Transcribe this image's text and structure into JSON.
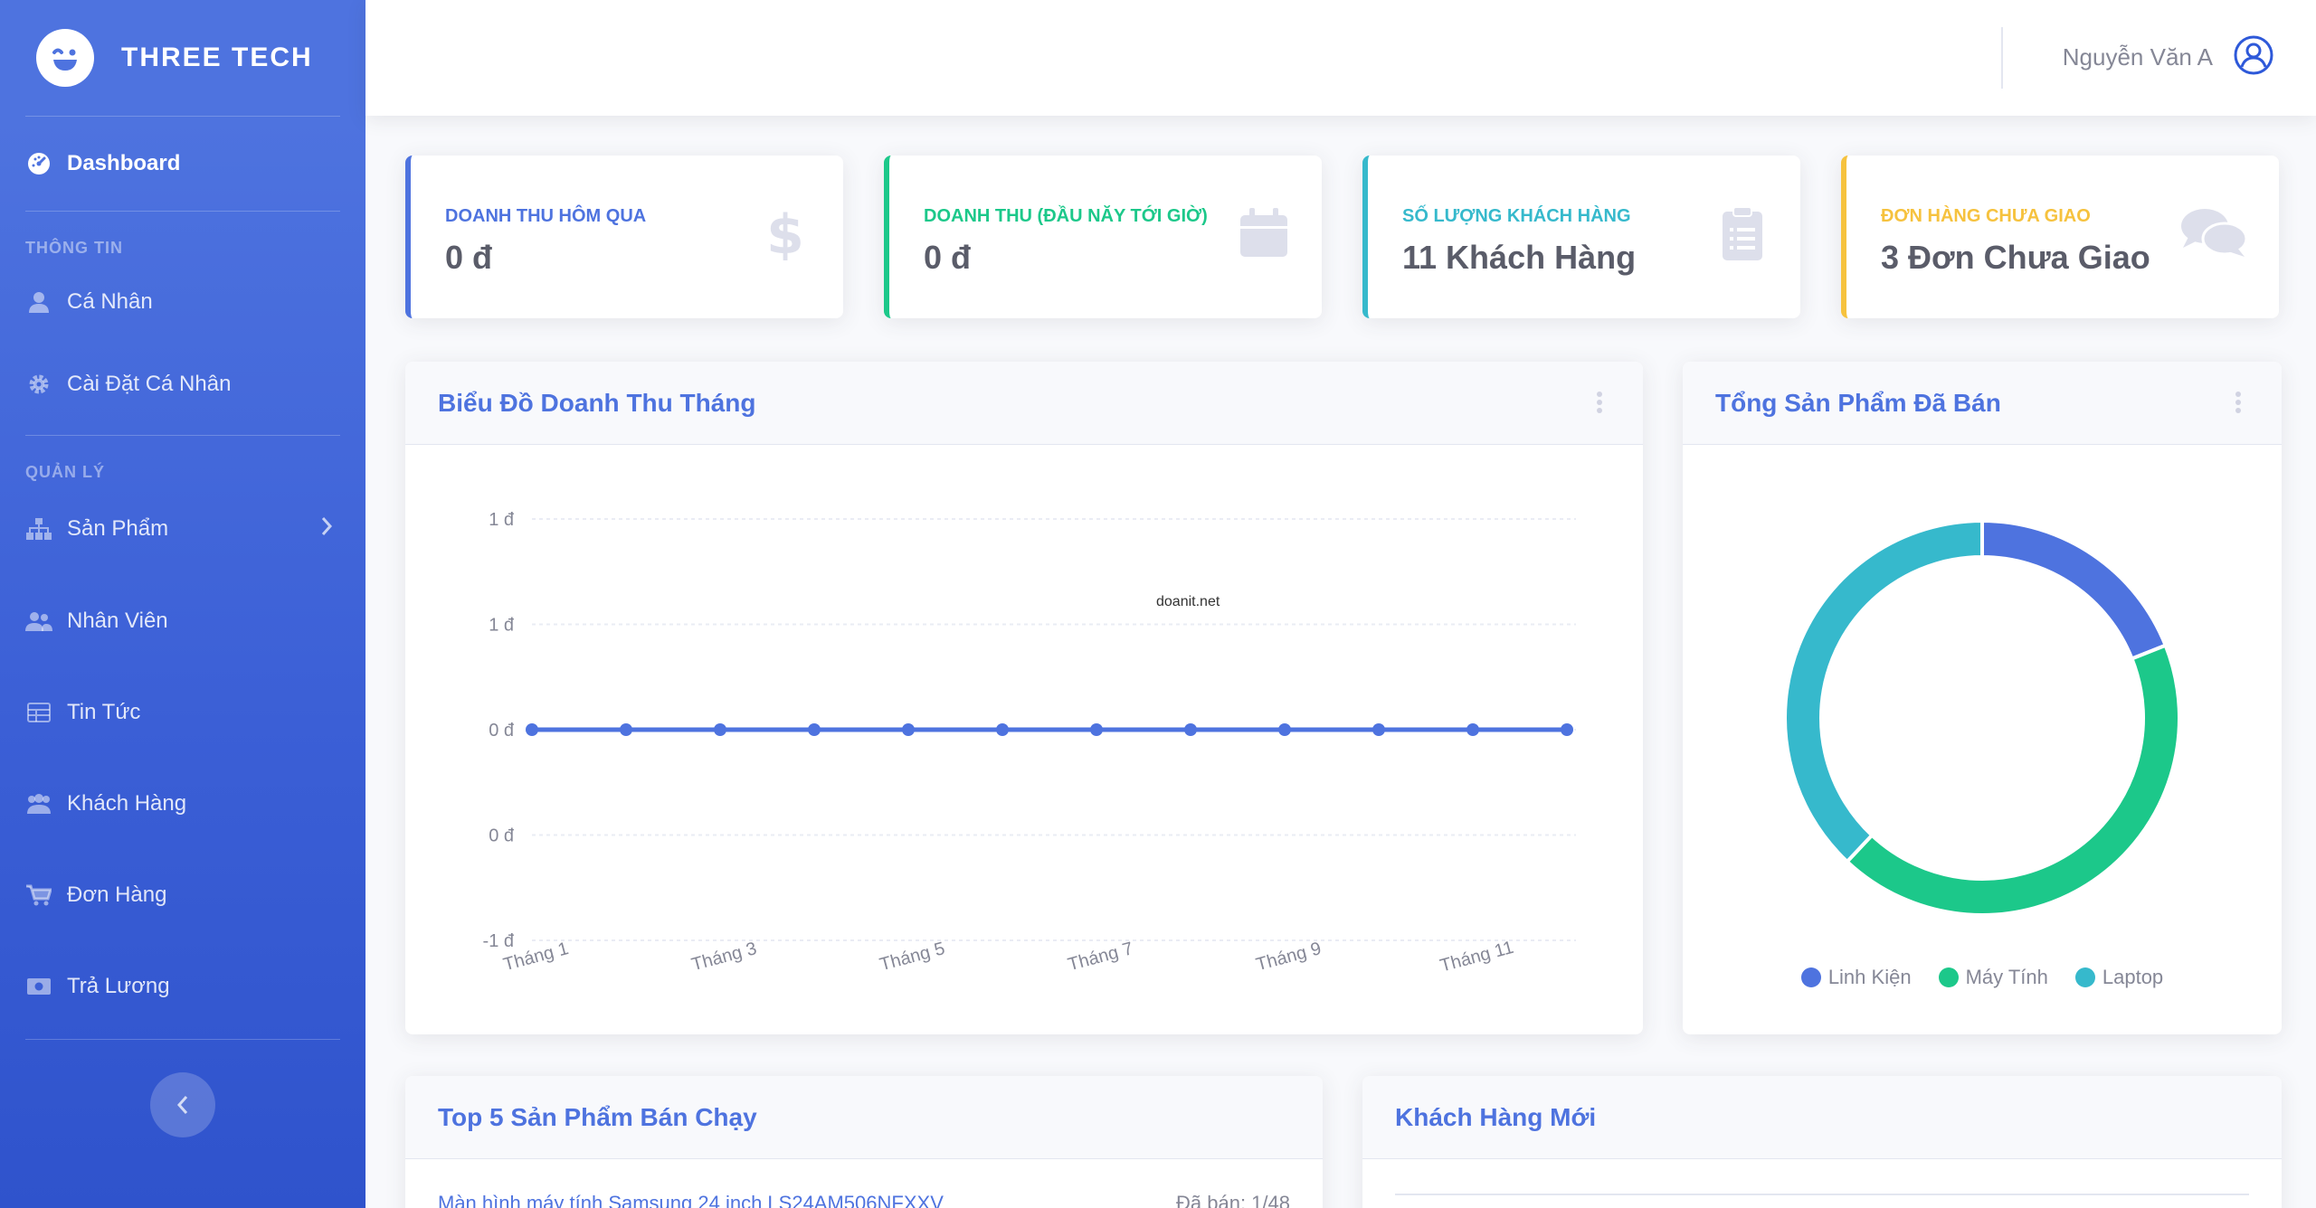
{
  "brand": {
    "name": "THREE TECH"
  },
  "sidebar": {
    "dashboard": "Dashboard",
    "section_info": "THÔNG TIN",
    "info_items": [
      "Cá Nhân",
      "Cài Đặt Cá Nhân"
    ],
    "section_manage": "QUẢN LÝ",
    "manage_items": [
      "Sản Phẩm",
      "Nhân Viên",
      "Tin Tức",
      "Khách Hàng",
      "Đơn Hàng",
      "Trả Lương"
    ]
  },
  "topbar": {
    "user_name": "Nguyễn Văn A"
  },
  "stats": [
    {
      "label": "DOANH THU HÔM QUA",
      "value": "0 đ",
      "color": "#4e73df",
      "icon": "dollar-icon"
    },
    {
      "label": "DOANH THU (ĐẦU NĂY TỚI GIỜ)",
      "value": "0 đ",
      "color": "#1cc88a",
      "icon": "calendar-icon"
    },
    {
      "label": "SỐ LƯỢNG KHÁCH HÀNG",
      "value": "11 Khách Hàng",
      "color": "#36b9cc",
      "icon": "clipboard-icon"
    },
    {
      "label": "ĐƠN HÀNG CHƯA GIAO",
      "value": "3 Đơn Chưa Giao",
      "color": "#f6c23e",
      "icon": "comments-icon"
    }
  ],
  "revenue_card": {
    "title": "Biểu Đồ Doanh Thu Tháng",
    "watermark": "doanit.net"
  },
  "products_card": {
    "title": "Tổng Sản Phẩm Đã Bán"
  },
  "top_card": {
    "title": "Top 5 Sản Phẩm Bán Chạy",
    "first_item": "Màn hình máy tính Samsung 24 inch LS24AM506NFXXV",
    "first_sold": "Đã bán: 1/48"
  },
  "customers_card": {
    "title": "Khách Hàng Mới"
  },
  "chart_data": [
    {
      "type": "line",
      "title": "Biểu Đồ Doanh Thu Tháng",
      "x": [
        1,
        2,
        3,
        4,
        5,
        6,
        7,
        8,
        9,
        10,
        11,
        12
      ],
      "x_tick_labels": [
        "Tháng 1",
        "Tháng 3",
        "Tháng 5",
        "Tháng 7",
        "Tháng 9",
        "Tháng 11"
      ],
      "y_tick_labels": [
        "1 đ",
        "1 đ",
        "0 đ",
        "0 đ",
        "-1 đ"
      ],
      "series": [
        {
          "values": [
            0,
            0,
            0,
            0,
            0,
            0,
            0,
            0,
            0,
            0,
            0,
            0
          ],
          "color": "#4e73df"
        }
      ],
      "ylim": [
        -1,
        1
      ],
      "grid": true
    },
    {
      "type": "pie",
      "title": "Tổng Sản Phẩm Đã Bán",
      "categories": [
        "Linh Kiện",
        "Máy Tính",
        "Laptop"
      ],
      "values": [
        19,
        43,
        38
      ],
      "colors": [
        "#4e73df",
        "#1cc88a",
        "#36b9cc"
      ],
      "legend": "bottom"
    }
  ]
}
